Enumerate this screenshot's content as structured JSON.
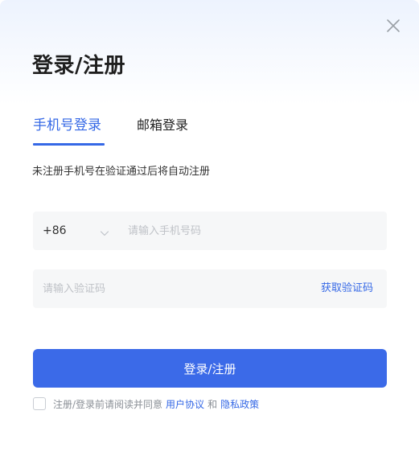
{
  "dialog": {
    "title": "登录/注册",
    "close_icon": "close-icon"
  },
  "tabs": [
    {
      "label": "手机号登录",
      "active": true
    },
    {
      "label": "邮箱登录",
      "active": false
    }
  ],
  "hint": "未注册手机号在验证通过后将自动注册",
  "phone": {
    "country_code": "+86",
    "dropdown_icon": "chevron-down-icon",
    "placeholder": "请输入手机号码",
    "value": ""
  },
  "code": {
    "placeholder": "请输入验证码",
    "value": "",
    "get_code_label": "获取验证码"
  },
  "submit_label": "登录/注册",
  "agreement": {
    "checked": false,
    "prefix": "注册/登录前请阅读并同意",
    "user_agreement": "用户协议",
    "and": "和",
    "privacy_policy": "隐私政策"
  },
  "colors": {
    "accent": "#3568e6",
    "button": "#3b6ae8",
    "field_bg": "#f6f7f8",
    "header_gradient_top": "#edf3fe"
  }
}
